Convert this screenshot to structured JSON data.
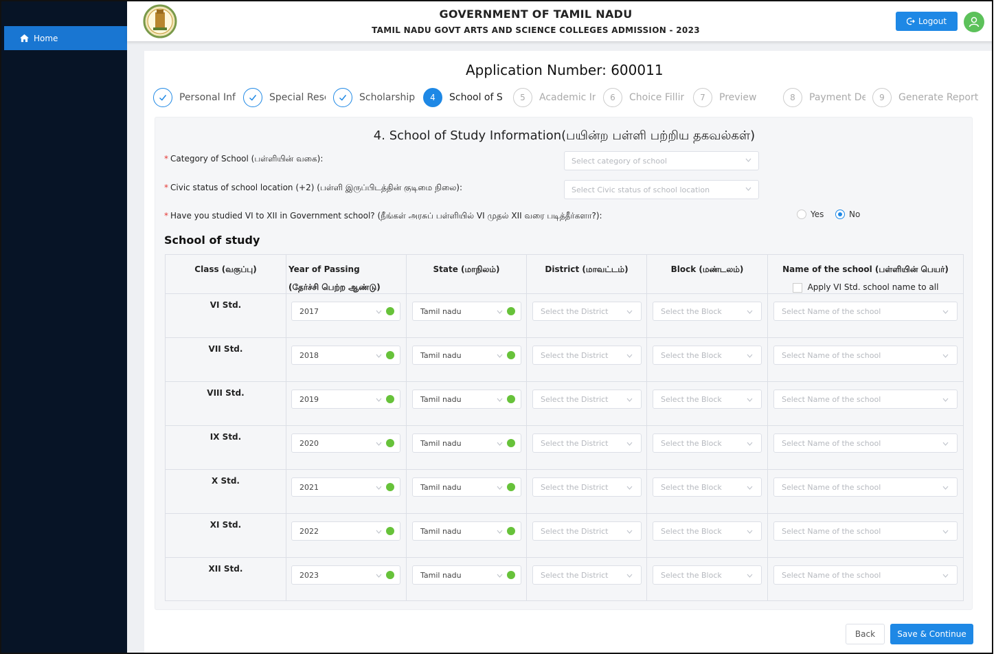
{
  "sidebar": {
    "home_label": "Home"
  },
  "header": {
    "title": "GOVERNMENT OF TAMIL NADU",
    "subtitle": "TAMIL NADU GOVT ARTS AND SCIENCE COLLEGES ADMISSION - 2023",
    "logout_label": "Logout"
  },
  "application": {
    "number_text": "Application Number: 600011"
  },
  "steps": [
    {
      "label": "Personal Inf",
      "status": "done",
      "num": "1"
    },
    {
      "label": "Special Rese",
      "status": "done",
      "num": "2"
    },
    {
      "label": "Scholarship",
      "status": "done",
      "num": "3"
    },
    {
      "label": "School of S",
      "status": "active",
      "num": "4"
    },
    {
      "label": "Academic Ir",
      "status": "todo",
      "num": "5"
    },
    {
      "label": "Choice Fillir",
      "status": "todo",
      "num": "6"
    },
    {
      "label": "Preview",
      "status": "todo",
      "num": "7"
    },
    {
      "label": "Payment De",
      "status": "todo",
      "num": "8"
    },
    {
      "label": "Generate Report",
      "status": "todo",
      "num": "9"
    }
  ],
  "section": {
    "title": "4. School of Study Information(பயின்ற பள்ளி பற்றிய தகவல்கள்)",
    "q_category": "Category of School (பள்ளியின் வகை):",
    "q_category_placeholder": "Select category of school",
    "q_civic": "Civic status of school location (+2) (பள்ளி இருப்பிடத்தின் குடிமை நிலை):",
    "q_civic_placeholder": "Select Civic status of school location",
    "q_govt": "Have you studied VI to XII in Government school? (நீங்கள் அரசுப் பள்ளியில் VI முதல் XII வரை படித்தீர்களா?):",
    "yes_label": "Yes",
    "no_label": "No",
    "govt_answer": "No",
    "school_of_study": "School of study"
  },
  "table": {
    "headers": {
      "class": "Class (வகுப்பு)",
      "year": "Year of Passing",
      "year_sub": "(தேர்ச்சி பெற்ற ஆண்டு)",
      "state": "State (மாநிலம்)",
      "district": "District (மாவட்டம்)",
      "block": "Block (மண்டலம்)",
      "school": "Name of the school (பள்ளியின் பெயர்)",
      "apply_all": "Apply VI Std. school name to all"
    },
    "district_placeholder": "Select the District",
    "block_placeholder": "Select the Block",
    "school_placeholder": "Select Name of the school",
    "rows": [
      {
        "class": "VI Std.",
        "year": "2017",
        "state": "Tamil nadu"
      },
      {
        "class": "VII Std.",
        "year": "2018",
        "state": "Tamil nadu"
      },
      {
        "class": "VIII Std.",
        "year": "2019",
        "state": "Tamil nadu"
      },
      {
        "class": "IX Std.",
        "year": "2020",
        "state": "Tamil nadu"
      },
      {
        "class": "X Std.",
        "year": "2021",
        "state": "Tamil nadu"
      },
      {
        "class": "XI Std.",
        "year": "2022",
        "state": "Tamil nadu"
      },
      {
        "class": "XII Std.",
        "year": "2023",
        "state": "Tamil nadu"
      }
    ]
  },
  "actions": {
    "back_label": "Back",
    "save_label": "Save & Continue"
  },
  "colors": {
    "primary": "#1e88e5",
    "sidebar": "#071426",
    "success": "#67c23a",
    "required": "#e53935"
  }
}
